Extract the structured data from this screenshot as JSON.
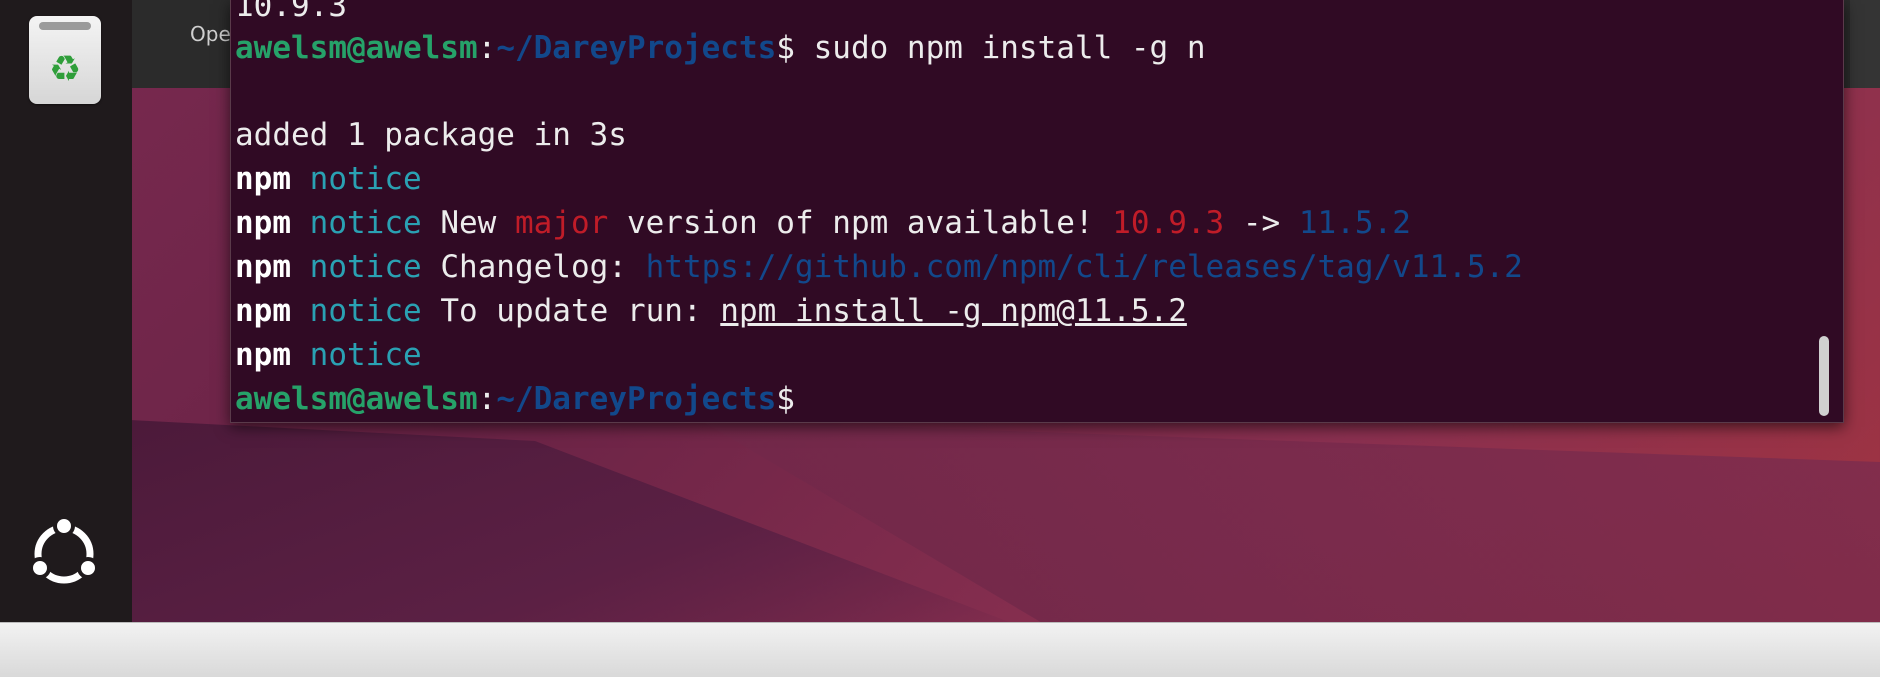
{
  "top_panel": {
    "open_label": "Ope"
  },
  "dock": {
    "trash_icon": "recycle-bin-icon",
    "trash_glyph": "♻",
    "launcher_icon": "ubuntu-logo-icon"
  },
  "terminal": {
    "prev_output": "10.9.3",
    "prompt_user": "awelsm@awelsm",
    "prompt_sep": ":",
    "prompt_path": "~/DareyProjects",
    "prompt_dollar": "$",
    "command": " sudo npm install -g n",
    "added_line": "added 1 package in 3s",
    "npm": "npm",
    "notice": "notice",
    "new_text": " New ",
    "major": "major",
    "version_text": " version of npm available! ",
    "old_version": "10.9.3",
    "arrow": " -> ",
    "new_version": "11.5.2",
    "changelog_label": " Changelog: ",
    "changelog_url": "https://github.com/npm/cli/releases/tag/v11.5.2",
    "update_label": " To update run: ",
    "update_cmd": "npm install -g npm@11.5.2"
  },
  "colors": {
    "terminal_bg": "#300a24",
    "prompt_green": "#26a269",
    "path_blue": "#12488b",
    "notice_cyan": "#2aa1b3",
    "major_red": "#c01c28"
  }
}
